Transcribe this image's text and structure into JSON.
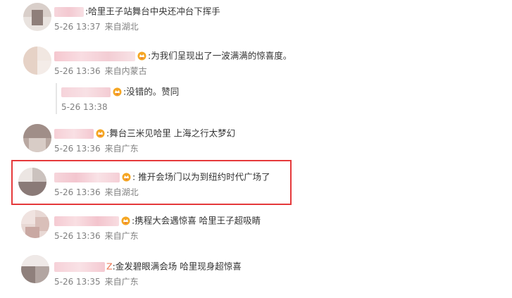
{
  "colors": {
    "highlight_border": "#e5393b",
    "meta_text": "#808080",
    "body_text": "#333333"
  },
  "comments": [
    {
      "text": ":哈里王子站舞台中央还冲台下挥手",
      "date": "5-26 13:37",
      "location": "来自湖北",
      "has_badge": false
    },
    {
      "text": ":为我们呈现出了一波满满的惊喜度。",
      "date": "5-26 13:36",
      "location": "来自内蒙古",
      "has_badge": true
    },
    {
      "text": ":没错的。赞同",
      "date": "5-26 13:38",
      "location": "",
      "has_badge": true,
      "is_reply": true
    },
    {
      "text": ":舞台三米见哈里 上海之行太梦幻",
      "date": "5-26 13:36",
      "location": "来自广东",
      "has_badge": true
    },
    {
      "text": ": 推开会场门以为到纽约时代广场了",
      "date": "5-26 13:36",
      "location": "来自湖北",
      "has_badge": true,
      "highlighted": true
    },
    {
      "text": ":携程大会遇惊喜 哈里王子超吸睛",
      "date": "5-26 13:36",
      "location": "来自广东",
      "has_badge": true
    },
    {
      "text": ":金发碧眼满会场 哈里现身超惊喜",
      "date": "5-26 13:35",
      "location": "来自广东",
      "has_badge": false,
      "name_suffix": "Z"
    }
  ]
}
